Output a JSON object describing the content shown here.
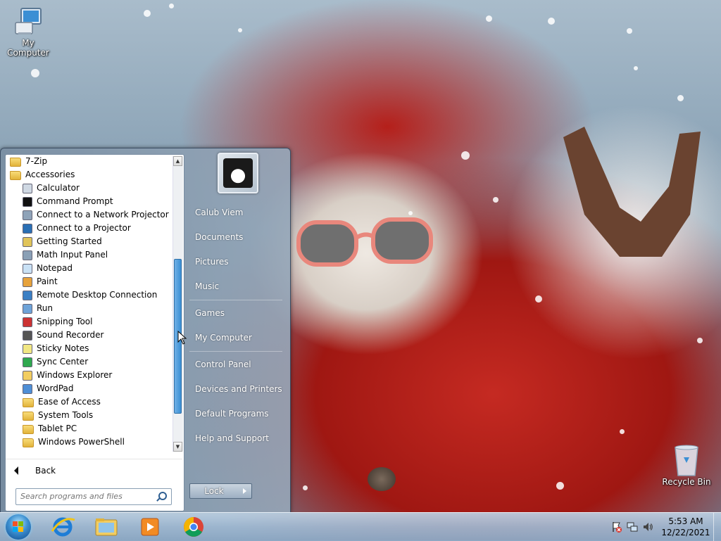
{
  "desktop": {
    "icons": [
      {
        "name": "My Computer"
      },
      {
        "name": "Recycle Bin"
      }
    ]
  },
  "start_menu": {
    "programs": [
      {
        "label": "7-Zip",
        "icon": "folder-icon",
        "level": 0
      },
      {
        "label": "Accessories",
        "icon": "folder-icon",
        "level": 0
      },
      {
        "label": "Calculator",
        "icon": "calculator-icon",
        "level": 1
      },
      {
        "label": "Command Prompt",
        "icon": "command-prompt-icon",
        "level": 1
      },
      {
        "label": "Connect to a Network Projector",
        "icon": "network-projector-icon",
        "level": 1
      },
      {
        "label": "Connect to a Projector",
        "icon": "projector-icon",
        "level": 1
      },
      {
        "label": "Getting Started",
        "icon": "getting-started-icon",
        "level": 1
      },
      {
        "label": "Math Input Panel",
        "icon": "math-input-icon",
        "level": 1
      },
      {
        "label": "Notepad",
        "icon": "notepad-icon",
        "level": 1
      },
      {
        "label": "Paint",
        "icon": "paint-icon",
        "level": 1
      },
      {
        "label": "Remote Desktop Connection",
        "icon": "remote-desktop-icon",
        "level": 1
      },
      {
        "label": "Run",
        "icon": "run-icon",
        "level": 1
      },
      {
        "label": "Snipping Tool",
        "icon": "snipping-tool-icon",
        "level": 1
      },
      {
        "label": "Sound Recorder",
        "icon": "microphone-icon",
        "level": 1
      },
      {
        "label": "Sticky Notes",
        "icon": "sticky-notes-icon",
        "level": 1
      },
      {
        "label": "Sync Center",
        "icon": "sync-icon",
        "level": 1
      },
      {
        "label": "Windows Explorer",
        "icon": "explorer-icon",
        "level": 1
      },
      {
        "label": "WordPad",
        "icon": "wordpad-icon",
        "level": 1
      },
      {
        "label": "Ease of Access",
        "icon": "folder-icon",
        "level": 1
      },
      {
        "label": "System Tools",
        "icon": "folder-icon",
        "level": 1
      },
      {
        "label": "Tablet PC",
        "icon": "folder-icon",
        "level": 1
      },
      {
        "label": "Windows PowerShell",
        "icon": "folder-icon",
        "level": 1
      }
    ],
    "back_label": "Back",
    "search_placeholder": "Search programs and files",
    "right_items": [
      {
        "label": "Calub Viem"
      },
      {
        "label": "Documents"
      },
      {
        "label": "Pictures"
      },
      {
        "label": "Music"
      },
      {
        "label": "Games"
      },
      {
        "label": "My Computer"
      },
      {
        "label": "Control Panel"
      },
      {
        "label": "Devices and Printers"
      },
      {
        "label": "Default Programs"
      },
      {
        "label": "Help and Support"
      }
    ],
    "lock_label": "Lock"
  },
  "taskbar": {
    "apps": [
      {
        "icon": "internet-explorer-icon"
      },
      {
        "icon": "file-explorer-icon"
      },
      {
        "icon": "media-player-icon"
      },
      {
        "icon": "chrome-icon"
      }
    ],
    "tray_icons": [
      "action-center-icon",
      "network-icon",
      "volume-icon"
    ],
    "time": "5:53 AM",
    "date": "12/22/2021"
  },
  "colors": {
    "scroll_thumb": "#3b8fd4",
    "taskbar": "#a0b9d2"
  }
}
